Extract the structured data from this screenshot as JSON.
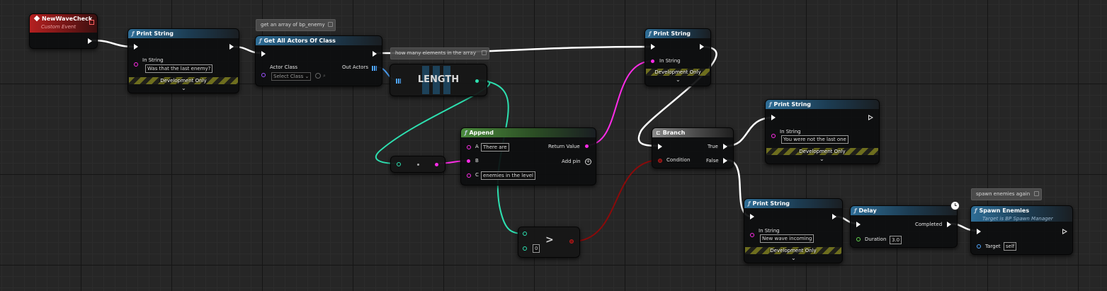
{
  "comments": {
    "get_all_actors": "get an array of bp_enemy",
    "length": "how many elements in the array",
    "spawn": "spawn enemies again"
  },
  "event_node": {
    "title": "NewWaveCheck",
    "subtitle": "Custom Event"
  },
  "print1": {
    "title": "Print String",
    "in_string_label": "In String",
    "in_string_value": "Was that the last enemy?",
    "dev_only": "Development Only"
  },
  "get_all": {
    "title": "Get All Actors Of Class",
    "actor_class_label": "Actor Class",
    "select_class": "Select Class",
    "out_actors_label": "Out Actors"
  },
  "length": {
    "label": "LENGTH"
  },
  "append": {
    "title": "Append",
    "a_label": "A",
    "a_value": "There are",
    "b_label": "B",
    "c_label": "C",
    "c_value": "enemies in the level",
    "return_label": "Return Value",
    "add_pin": "Add pin"
  },
  "print2": {
    "title": "Print String",
    "in_string_label": "In String",
    "dev_only": "Development Only"
  },
  "branch": {
    "title": "Branch",
    "condition_label": "Condition",
    "true_label": "True",
    "false_label": "False"
  },
  "print3": {
    "title": "Print String",
    "in_string_label": "In String",
    "in_string_value": "You were not the last one",
    "dev_only": "Development Only"
  },
  "greater": {
    "op": ">",
    "b_value": "0"
  },
  "print4": {
    "title": "Print String",
    "in_string_label": "In String",
    "in_string_value": "New wave incoming",
    "dev_only": "Development Only"
  },
  "delay": {
    "title": "Delay",
    "duration_label": "Duration",
    "duration_value": "3.0",
    "completed_label": "Completed"
  },
  "spawn": {
    "title": "Spawn Enemies",
    "subtitle": "Target is BP Spawn Manager",
    "target_label": "Target",
    "target_value": "self"
  },
  "colors": {
    "exec": "#ffffff",
    "string": "#ff2ce8",
    "integer": "#2de0b0",
    "boolean": "#8b0000",
    "float": "#64d64e",
    "object": "#4fa6ff",
    "class": "#9e52ff"
  },
  "icons": {
    "function": "f-icon",
    "event": "event-diamond-icon",
    "branch": "branch-icon",
    "delay": "clock-icon"
  }
}
